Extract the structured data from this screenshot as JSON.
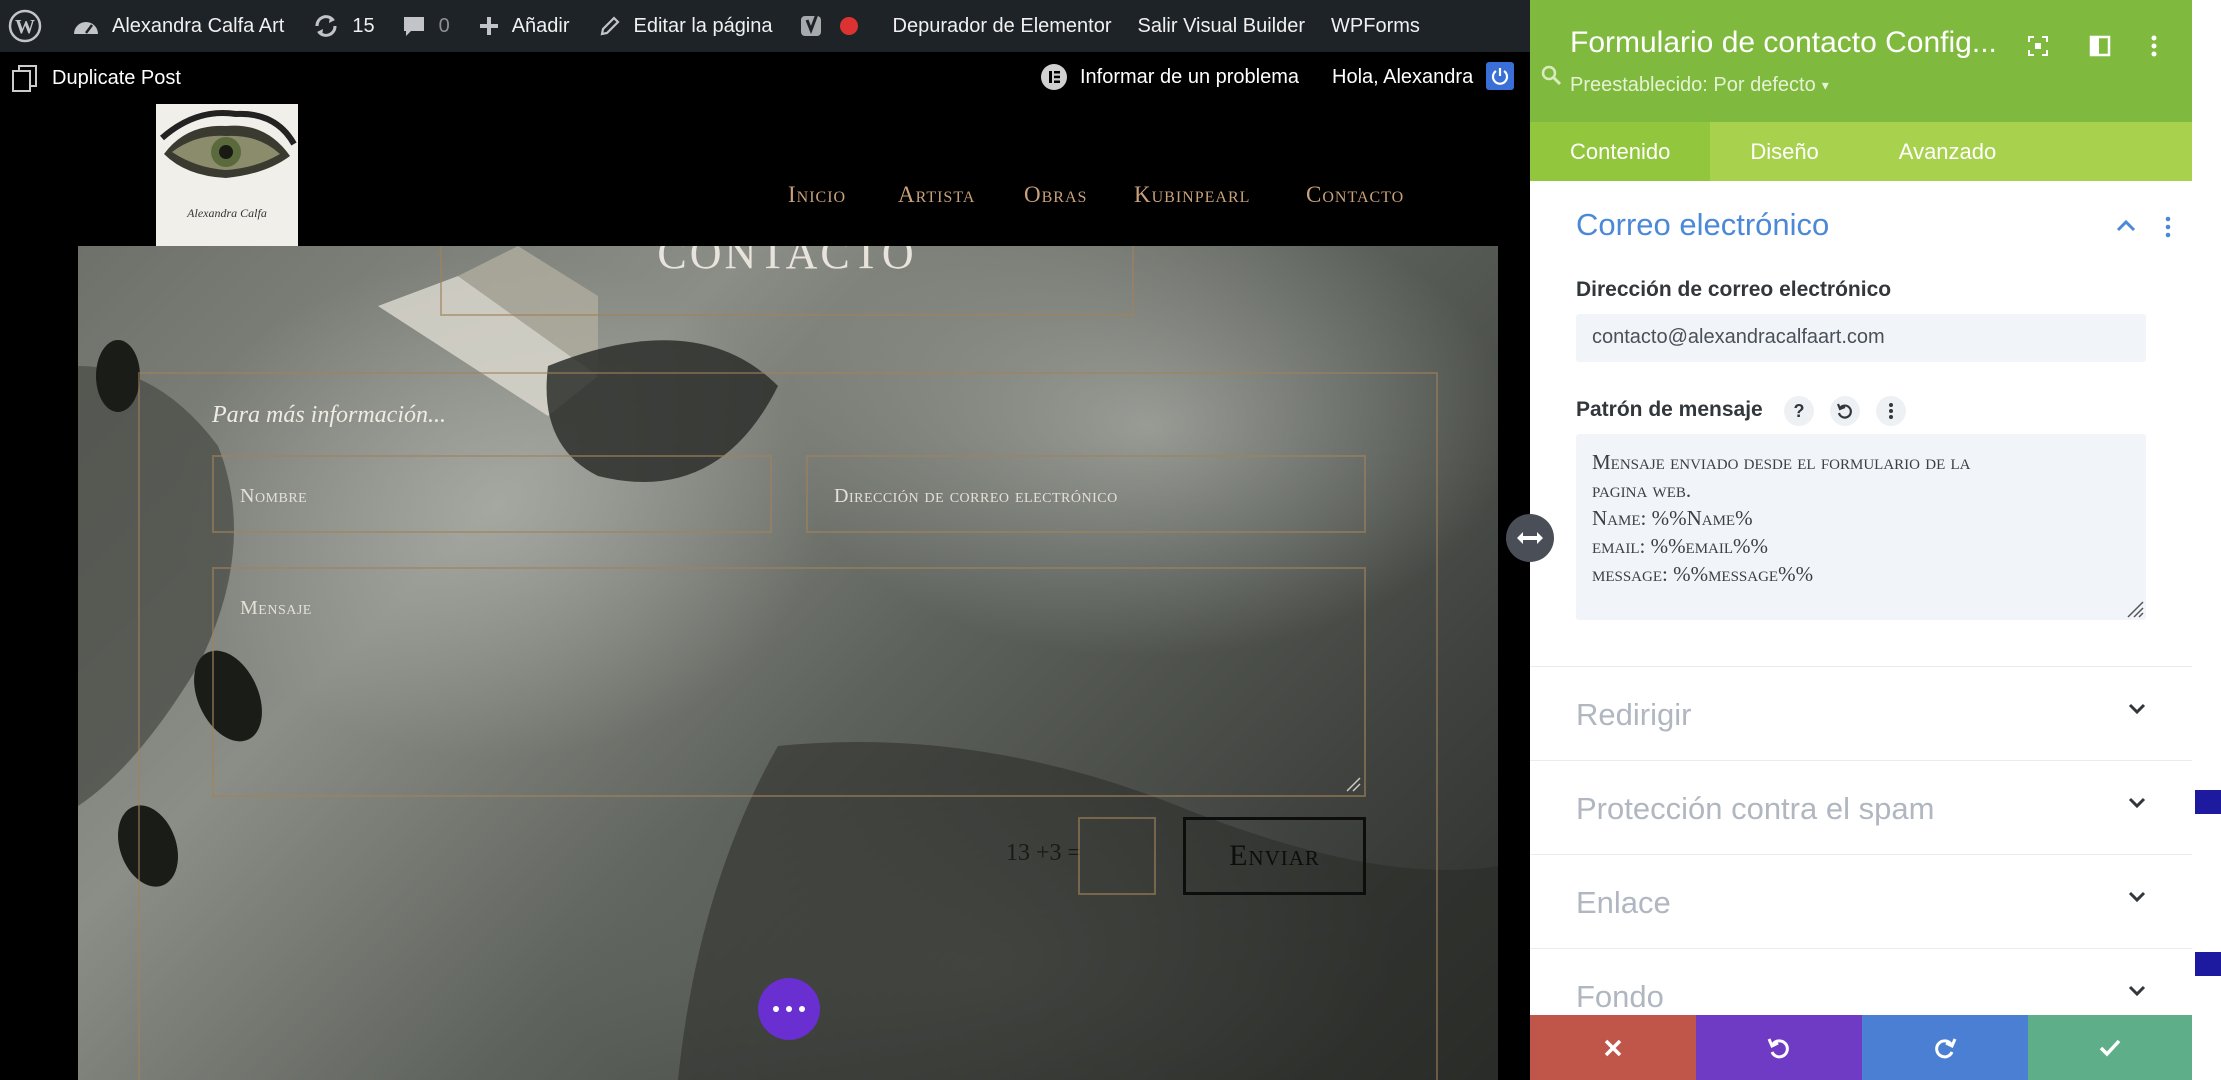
{
  "admin_bar": {
    "site_name": "Alexandra Calfa Art",
    "updates_count": "15",
    "comments_count": "0",
    "new_label": "Añadir",
    "edit_page_label": "Editar la página",
    "elementor_debugger_label": "Depurador de Elementor",
    "exit_builder_label": "Salir Visual Builder",
    "wpforms_label": "WPForms"
  },
  "second_bar": {
    "duplicate_post_label": "Duplicate Post",
    "report_problem_label": "Informar de un problema",
    "greeting": "Hola, Alexandra"
  },
  "site": {
    "logo_text": "Alexandra Calfa",
    "nav": [
      "Inicio",
      "Artista",
      "Obras",
      "Kubinpearl",
      "Contacto"
    ],
    "hero_title": "CONTACTO"
  },
  "form": {
    "intro": "Para más información...",
    "name_placeholder": "Nombre",
    "email_placeholder": "Dirección de correo electrónico",
    "message_placeholder": "Mensaje",
    "captcha": "13 +3 =",
    "submit_label": "Enviar"
  },
  "panel": {
    "title": "Formulario de contacto Config...",
    "preset_label": "Preestablecido: Por defecto",
    "tabs": [
      "Contenido",
      "Diseño",
      "Avanzado"
    ],
    "section_email": {
      "title": "Correo electrónico",
      "email_label": "Dirección de correo electrónico",
      "email_value": "contacto@alexandracalfaart.com",
      "pattern_label": "Patrón de mensaje",
      "pattern_lines": [
        "Mensaje enviado desde el formulario de la",
        "pagina web.",
        "Name: %%Name%",
        "email: %%email%%",
        "message: %%message%%"
      ]
    },
    "collapsed_sections": [
      "Redirigir",
      "Protección contra el spam",
      "Enlace",
      "Fondo"
    ]
  },
  "colors": {
    "admin_bar_bg": "#1d2327",
    "panel_header": "#7fba3f",
    "panel_tabs": "#a8d24e",
    "section_title_blue": "#4c88d8",
    "cancel_red": "#c0564a",
    "undo_purple": "#6f3ac4",
    "redo_blue": "#4b7fd4",
    "save_green": "#5fae8a",
    "nav_gold": "#c9a27a",
    "fab_purple": "#6a2fd0"
  }
}
